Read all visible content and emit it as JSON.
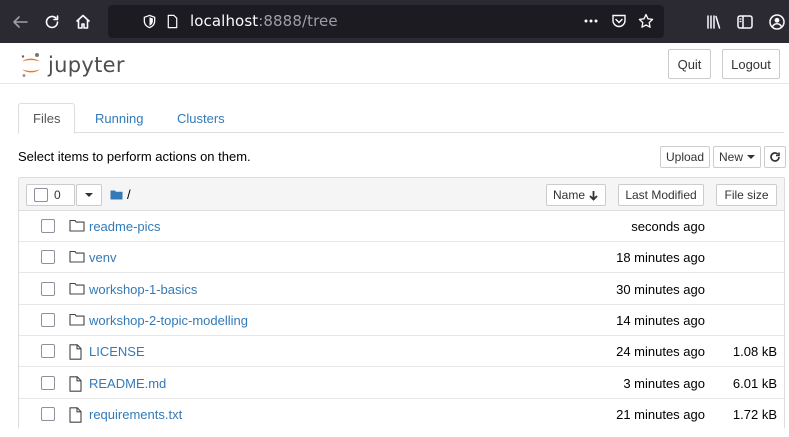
{
  "browser": {
    "url_host": "localhost",
    "url_rest": ":8888/tree"
  },
  "header": {
    "logo_text": "jupyter",
    "quit_label": "Quit",
    "logout_label": "Logout"
  },
  "tabs": [
    {
      "label": "Files",
      "active": true
    },
    {
      "label": "Running",
      "active": false
    },
    {
      "label": "Clusters",
      "active": false
    }
  ],
  "toolbar": {
    "info_text": "Select items to perform actions on them.",
    "upload_label": "Upload",
    "new_label": "New"
  },
  "list_header": {
    "selected_count": "0",
    "breadcrumb": "/",
    "col_name": "Name",
    "col_modified": "Last Modified",
    "col_size": "File size"
  },
  "files": [
    {
      "name": "readme-pics",
      "type": "folder",
      "modified": "seconds ago",
      "size": ""
    },
    {
      "name": "venv",
      "type": "folder",
      "modified": "18 minutes ago",
      "size": ""
    },
    {
      "name": "workshop-1-basics",
      "type": "folder",
      "modified": "30 minutes ago",
      "size": ""
    },
    {
      "name": "workshop-2-topic-modelling",
      "type": "folder",
      "modified": "14 minutes ago",
      "size": ""
    },
    {
      "name": "LICENSE",
      "type": "file",
      "modified": "24 minutes ago",
      "size": "1.08 kB"
    },
    {
      "name": "README.md",
      "type": "file",
      "modified": "3 minutes ago",
      "size": "6.01 kB"
    },
    {
      "name": "requirements.txt",
      "type": "file",
      "modified": "21 minutes ago",
      "size": "1.72 kB"
    }
  ],
  "colors": {
    "chrome_bg": "#2b2a33",
    "link": "#337ab7",
    "jupyter_orange": "#f37626"
  }
}
